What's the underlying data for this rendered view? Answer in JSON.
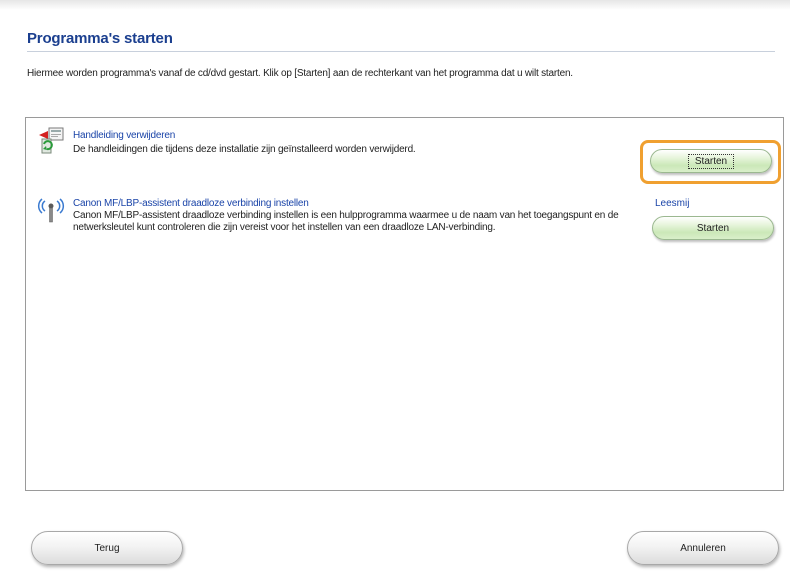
{
  "page": {
    "title": "Programma's starten",
    "intro": "Hiermee worden programma's vanaf de cd/dvd gestart. Klik op [Starten] aan de rechterkant van het programma dat u wilt starten."
  },
  "items": [
    {
      "icon": "manual-uninstall-icon",
      "title": "Handleiding verwijderen",
      "description": "De handleidingen die tijdens deze installatie zijn geïnstalleerd worden verwijderd.",
      "readme_label": "",
      "start_label": "Starten",
      "focused": true
    },
    {
      "icon": "wireless-signal-icon",
      "title": "Canon MF/LBP-assistent draadloze verbinding instellen",
      "description": "Canon MF/LBP-assistent draadloze verbinding instellen is een hulpprogramma waarmee u de naam van het toegangspunt en de netwerksleutel kunt controleren die zijn vereist voor het instellen van een draadloze LAN-verbinding.",
      "readme_label": "Leesmij",
      "start_label": "Starten",
      "focused": false
    }
  ],
  "footer": {
    "back_label": "Terug",
    "cancel_label": "Annuleren"
  },
  "colors": {
    "title": "#1b3f8f",
    "link": "#1a44a8",
    "focus": "#f0a030",
    "button_green": "#cbe8b8"
  }
}
